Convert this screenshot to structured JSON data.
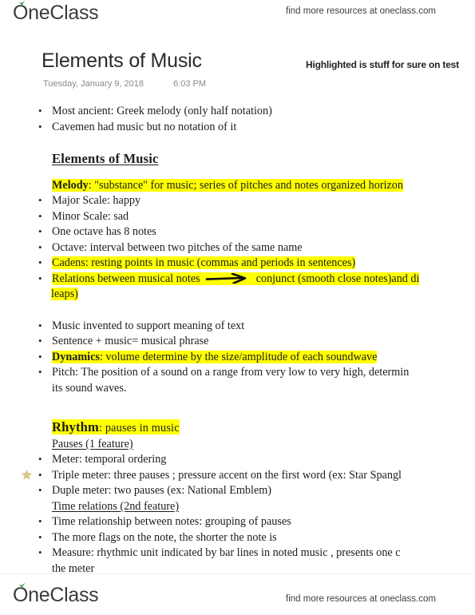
{
  "brand": {
    "logo_text": "OneClass",
    "logo_icon": "leaf-icon",
    "header_tagline": "find more resources at oneclass.com",
    "footer_tagline": "find more resources at oneclass.com"
  },
  "document": {
    "title": "Elements of Music",
    "date": "Tuesday,  January 9, 2018",
    "time": "6:03 PM",
    "annotation": "Highlighted is stuff for sure on test"
  },
  "colors": {
    "highlight": "#ffff00",
    "star": "#ddc68f",
    "text": "#1d1d1d",
    "muted": "#8a8a8a"
  },
  "content": {
    "intro_bullets": [
      "Most ancient: Greek melody (only half notation)",
      "Cavemen had music but no notation of it"
    ],
    "section_heading": "Elements of Music",
    "melody_label": "Melody",
    "melody_text": ": \"substance\" for music; series of pitches and notes organized horizon",
    "melody_bullets": [
      "Major Scale: happy",
      "Minor Scale: sad",
      "One octave has 8  notes",
      "Octave: interval between two pitches of the same name"
    ],
    "cadens_bullet": "Cadens: resting points in music  (commas and periods in sentences)",
    "relations_pre": "Relations between musical notes",
    "relations_arrow": "right-arrow-icon",
    "relations_post": "conjunct  (smooth close notes)and di",
    "relations_wrap": "leaps)",
    "music_bullets": [
      "Music invented to support meaning of text",
      "Sentence + music= musical phrase"
    ],
    "dynamics_label": "Dynamics",
    "dynamics_text": ": volume determine by the size/amplitude of each soundwave",
    "pitch_line_1": "Pitch: The position of a sound on a range from very low to very high, determin",
    "pitch_line_2": "its sound waves.",
    "rhythm_label": "Rhythm",
    "rhythm_text": ": pauses in music",
    "pauses_heading": "Pauses (1 feature)",
    "meter_bullet": "Meter: temporal ordering",
    "triple_meter_bullet": "Triple meter: three pauses ; pressure accent on the first word (ex: Star Spangl",
    "triple_meter_star": "star-icon",
    "duple_meter_bullet": "Duple meter: two pauses  (ex: National Emblem)",
    "time_relations_heading": "Time relations (2nd feature)",
    "time_bullets": [
      "Time relationship between notes: grouping of pauses",
      "The more flags on the note, the shorter the note is"
    ],
    "measure_line_1": "Measure: rhythmic unit indicated by bar lines in noted music , presents one c",
    "measure_line_2": "the meter"
  }
}
